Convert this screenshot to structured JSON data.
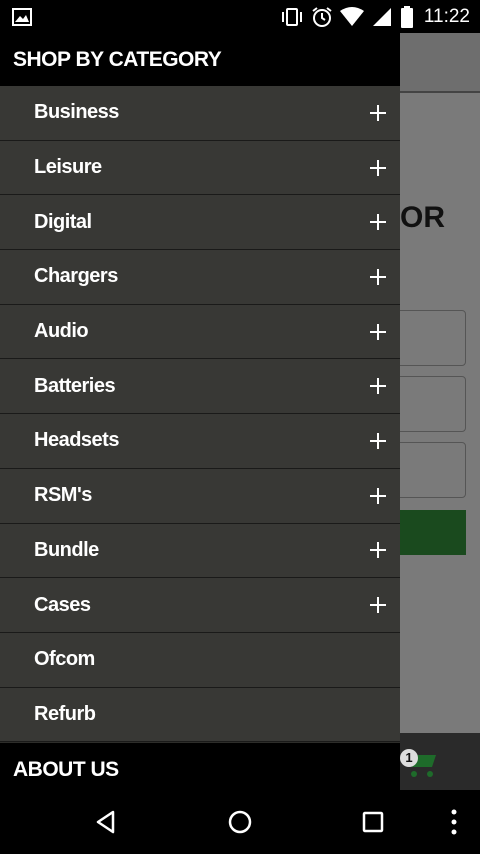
{
  "status_bar": {
    "time": "11:22",
    "icons": [
      "image-notification-icon",
      "vibrate-icon",
      "alarm-icon",
      "wifi-icon",
      "signal-icon",
      "battery-icon"
    ]
  },
  "background": {
    "heading_fragment": "OR",
    "cart_count": "1"
  },
  "drawer": {
    "header": "SHOP BY CATEGORY",
    "categories": [
      {
        "label": "Business",
        "expandable": true
      },
      {
        "label": "Leisure",
        "expandable": true
      },
      {
        "label": "Digital",
        "expandable": true
      },
      {
        "label": "Chargers",
        "expandable": true
      },
      {
        "label": "Audio",
        "expandable": true
      },
      {
        "label": "Batteries",
        "expandable": true
      },
      {
        "label": "Headsets",
        "expandable": true
      },
      {
        "label": "RSM's",
        "expandable": true
      },
      {
        "label": "Bundle",
        "expandable": true
      },
      {
        "label": "Cases",
        "expandable": true
      },
      {
        "label": "Ofcom",
        "expandable": false
      },
      {
        "label": "Refurb",
        "expandable": false
      }
    ],
    "footer": "ABOUT US"
  },
  "nav_bar": {
    "buttons": [
      "back-icon",
      "home-icon",
      "recents-icon",
      "overflow-menu-icon"
    ]
  },
  "colors": {
    "drawer_bg": "#383835",
    "drawer_header_bg": "#000000",
    "scrim": "#7a7a7a",
    "accent_green": "#1a4a1e"
  }
}
